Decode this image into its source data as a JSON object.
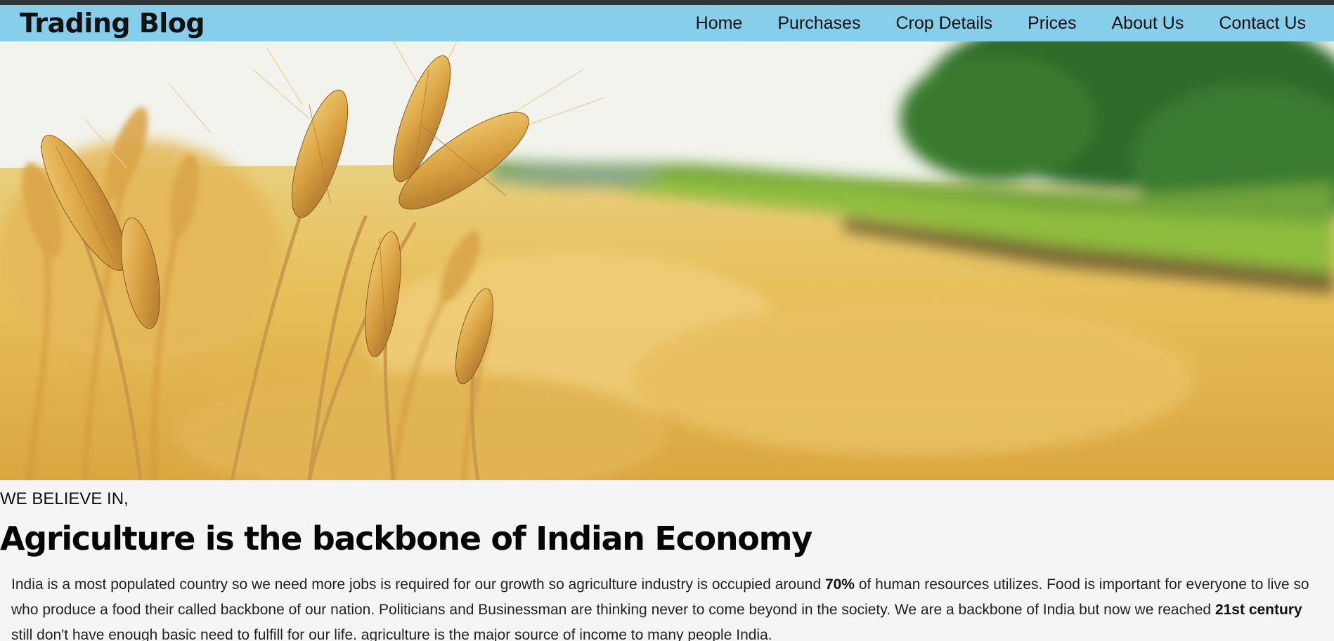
{
  "navbar": {
    "brand": "Trading Blog",
    "links": [
      "Home",
      "Purchases",
      "Crop Details",
      "Prices",
      "About Us",
      "Contact Us"
    ]
  },
  "hero": {
    "image": "wheat-field-photo"
  },
  "content": {
    "kicker": "WE BELIEVE IN,",
    "headline": "Agriculture is the backbone of Indian Economy",
    "paragraph": {
      "part1": "India is a most populated country so we need more jobs is required for our growth so agriculture industry is occupied around ",
      "bold1": "70%",
      "part2": " of human resources utilizes. Food is important for everyone to live so who produce a food their called backbone of our nation. Politicians and Businessman are thinking never to come beyond in the society. We are a backbone of India but now we reached ",
      "bold2": "21st century",
      "part3": " still don't have enough basic need to fulfill for our life. agriculture is the major source of income to many people India."
    }
  },
  "colors": {
    "navbar_bg": "#87ceeb",
    "top_strip": "#2e3338",
    "page_bg": "#f5f5f5"
  }
}
